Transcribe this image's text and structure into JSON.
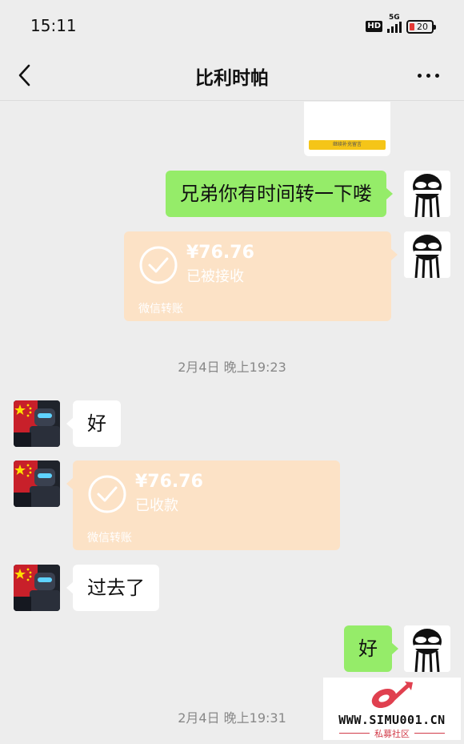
{
  "status_bar": {
    "time": "15:11",
    "network": "5G",
    "hd": "HD",
    "battery": "20"
  },
  "header": {
    "title": "比利时帕"
  },
  "messages": {
    "m1_text": "兄弟你有时间转一下喽",
    "transfer1": {
      "amount": "¥76.76",
      "status": "已被接收",
      "footer": "微信转账"
    },
    "time1": "2月4日 晚上19:23",
    "m2_text": "好",
    "transfer2": {
      "amount": "¥76.76",
      "status": "已收款",
      "footer": "微信转账"
    },
    "m3_text": "过去了",
    "m4_text": "好",
    "time2": "2月4日 晚上19:31"
  },
  "image_preview": {
    "button_text": "继续补充留言"
  },
  "watermark": {
    "site": "WWW.SIMU001.CN",
    "subtitle": "私募社区"
  },
  "colors": {
    "background": "#ededed",
    "my_bubble": "#95ec69",
    "other_bubble": "#ffffff",
    "transfer_bubble": "#fce2c6"
  }
}
